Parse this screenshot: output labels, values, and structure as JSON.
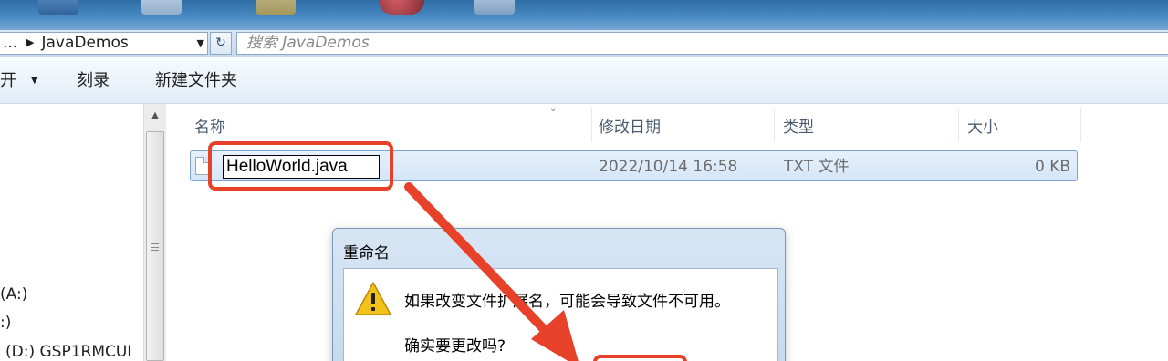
{
  "desktop": {
    "labels": [
      "",
      "",
      "",
      "",
      ""
    ]
  },
  "address_bar": {
    "path_prefix": "...",
    "path_folder": "JavaDemos",
    "search_placeholder": "搜索 JavaDemos"
  },
  "toolbar": {
    "open_label": "开",
    "burn_label": "刻录",
    "new_folder_label": "新建文件夹"
  },
  "nav": {
    "items": [
      "(A:)",
      ":)",
      "(D:) GSP1RMCUI"
    ]
  },
  "columns": {
    "name": "名称",
    "modified": "修改日期",
    "type": "类型",
    "size": "大小"
  },
  "file": {
    "name": "HelloWorld.java",
    "modified": "2022/10/14 16:58",
    "type": "TXT 文件",
    "size": "0 KB"
  },
  "dialog": {
    "title": "重命名",
    "message": "如果改变文件扩展名，可能会导致文件不可用。",
    "question": "确实要更改吗?"
  },
  "colors": {
    "annotation": "#e7412a",
    "selection": "#d4e6f8",
    "warning": "#f2c21a"
  }
}
